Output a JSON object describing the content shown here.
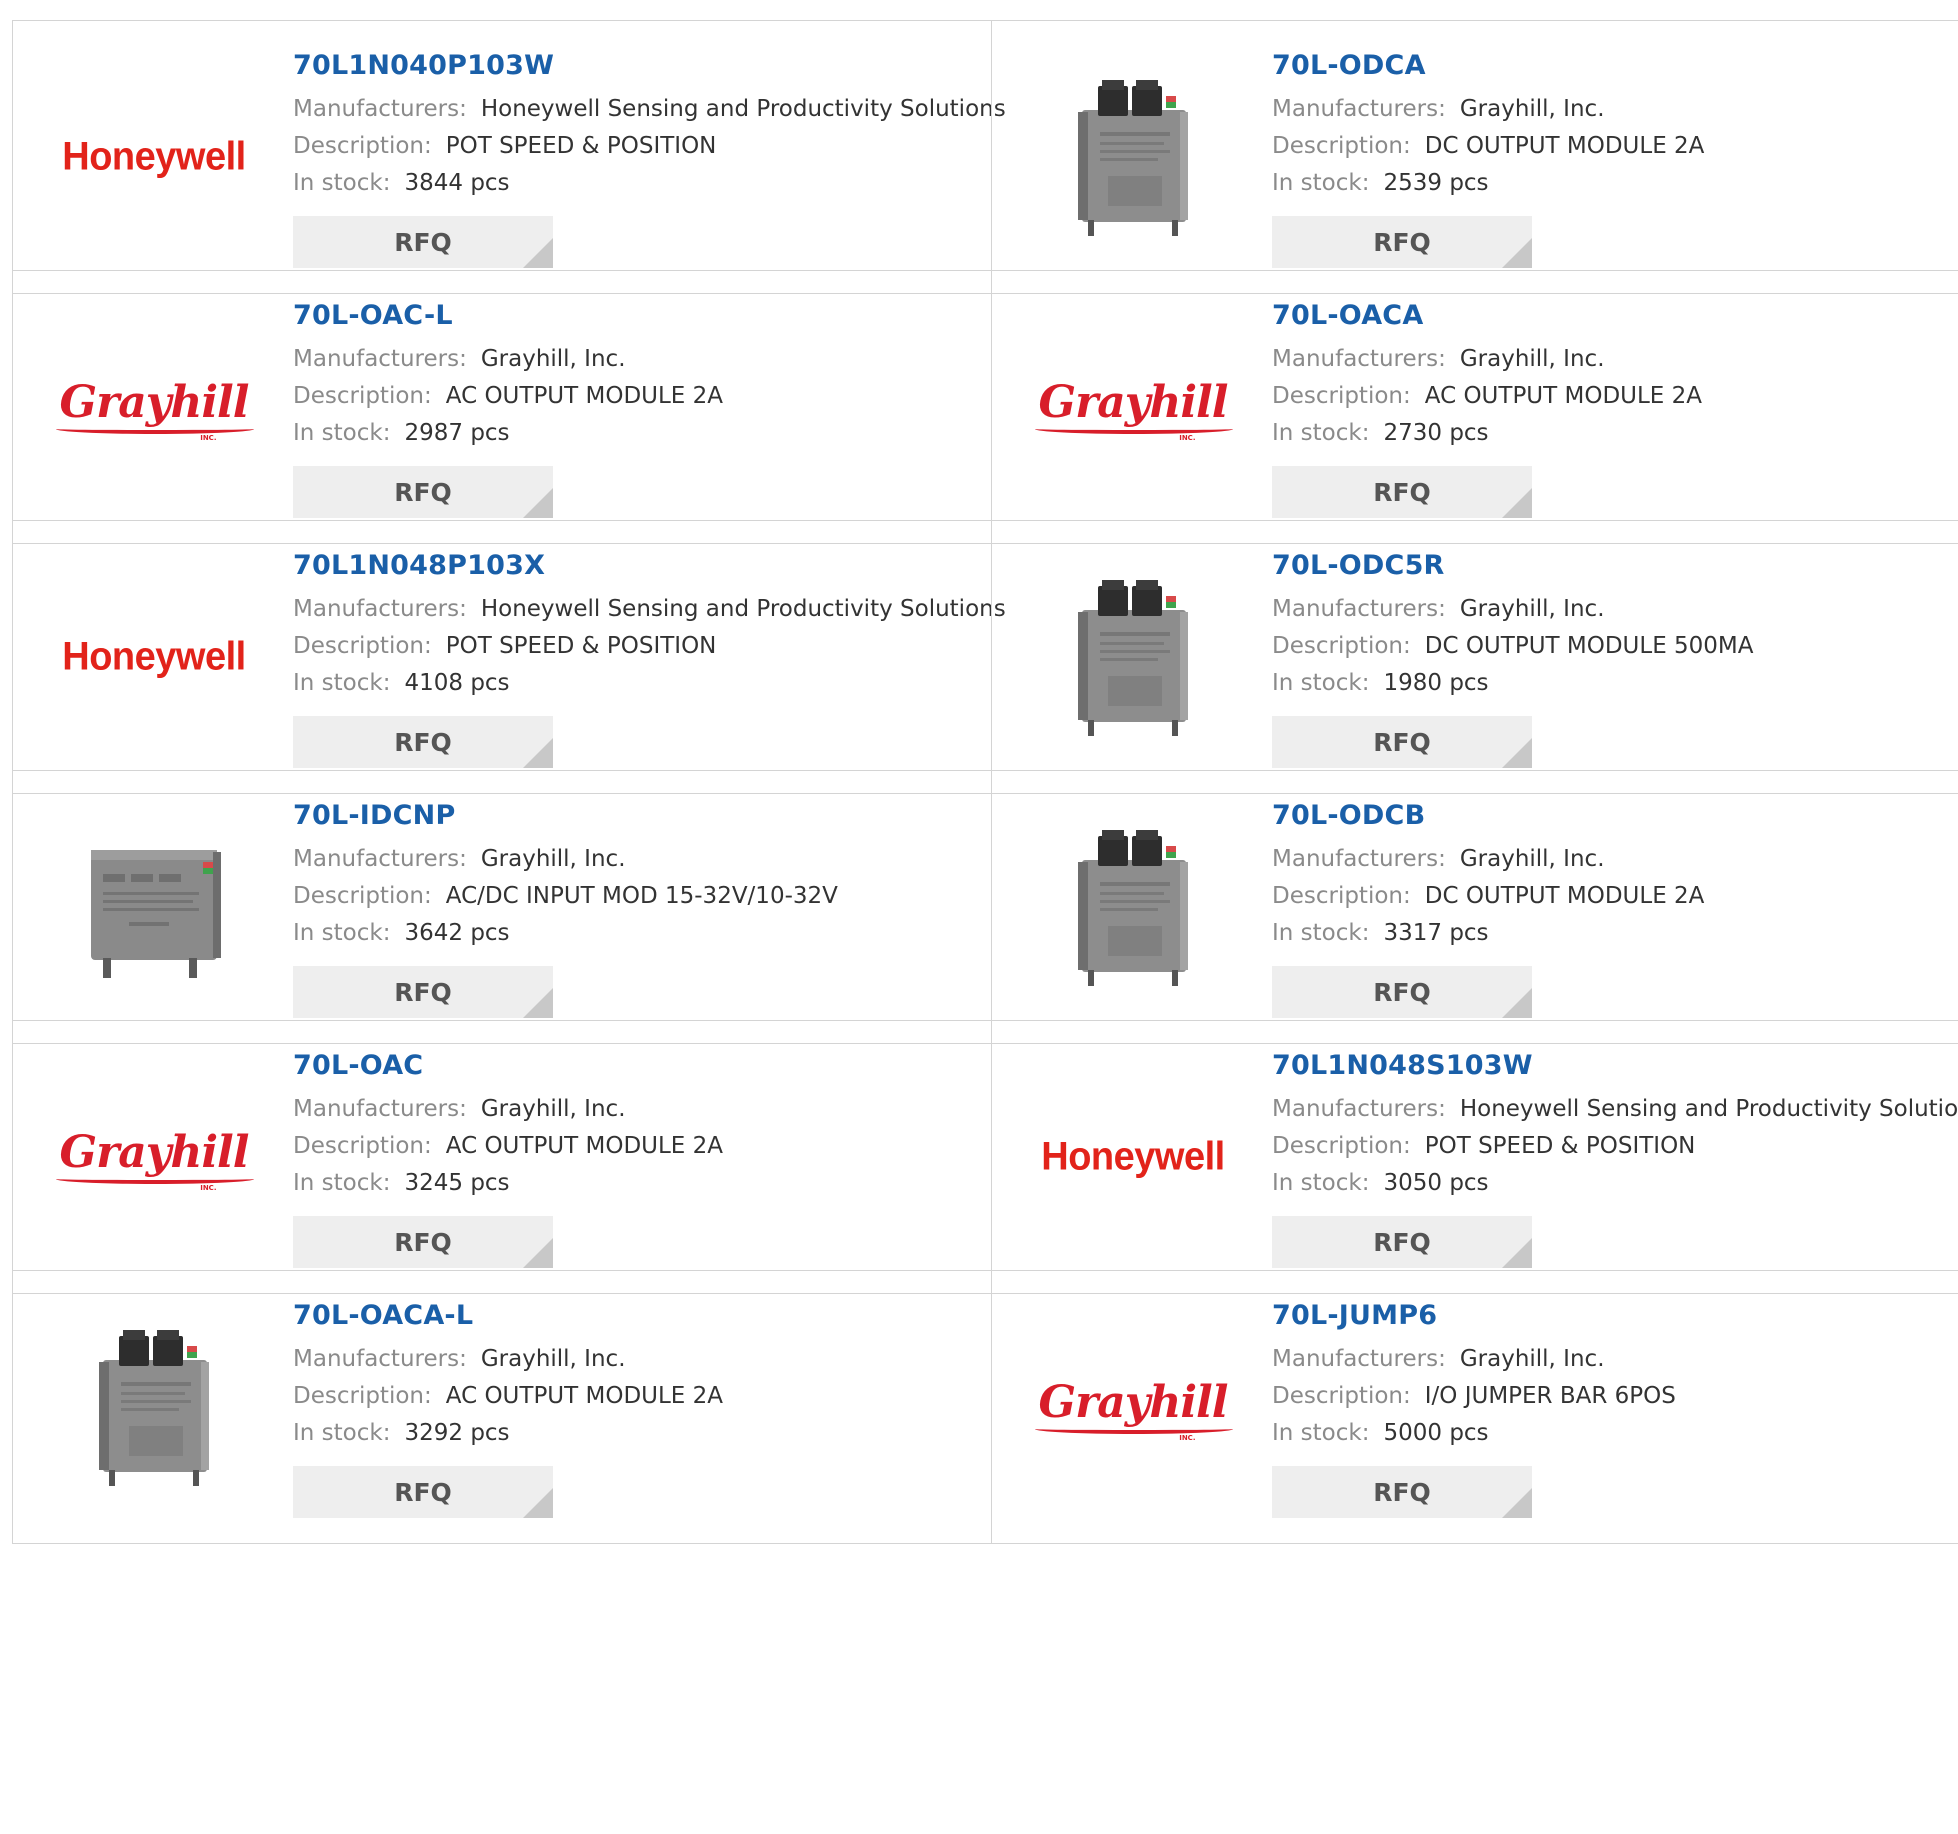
{
  "labels": {
    "manufacturers": "Manufacturers:",
    "description": "Description:",
    "in_stock": "In stock:",
    "rfq": "RFQ"
  },
  "products": [
    {
      "part": "70L1N040P103W",
      "manufacturer": "Honeywell Sensing and Productivity Solutions",
      "description": "POT SPEED & POSITION",
      "stock": "3844 pcs",
      "image": "honeywell-logo",
      "logo_text": "Honeywell"
    },
    {
      "part": "70L-ODCA",
      "manufacturer": "Grayhill, Inc.",
      "description": "DC OUTPUT MODULE 2A",
      "stock": "2539 pcs",
      "image": "io-module-photo"
    },
    {
      "part": "70L-OAC-L",
      "manufacturer": "Grayhill, Inc.",
      "description": "AC OUTPUT MODULE 2A",
      "stock": "2987 pcs",
      "image": "grayhill-logo",
      "logo_text": "Grayhill"
    },
    {
      "part": "70L-OACA",
      "manufacturer": "Grayhill, Inc.",
      "description": "AC OUTPUT MODULE 2A",
      "stock": "2730 pcs",
      "image": "grayhill-logo",
      "logo_text": "Grayhill"
    },
    {
      "part": "70L1N048P103X",
      "manufacturer": "Honeywell Sensing and Productivity Solutions",
      "description": "POT SPEED & POSITION",
      "stock": "4108 pcs",
      "image": "honeywell-logo",
      "logo_text": "Honeywell"
    },
    {
      "part": "70L-ODC5R",
      "manufacturer": "Grayhill, Inc.",
      "description": "DC OUTPUT MODULE 500MA",
      "stock": "1980 pcs",
      "image": "io-module-photo"
    },
    {
      "part": "70L-IDCNP",
      "manufacturer": "Grayhill, Inc.",
      "description": "AC/DC INPUT MOD 15-32V/10-32V",
      "stock": "3642 pcs",
      "image": "input-module-photo"
    },
    {
      "part": "70L-ODCB",
      "manufacturer": "Grayhill, Inc.",
      "description": "DC OUTPUT MODULE 2A",
      "stock": "3317 pcs",
      "image": "io-module-photo"
    },
    {
      "part": "70L-OAC",
      "manufacturer": "Grayhill, Inc.",
      "description": "AC OUTPUT MODULE 2A",
      "stock": "3245 pcs",
      "image": "grayhill-logo",
      "logo_text": "Grayhill"
    },
    {
      "part": "70L1N048S103W",
      "manufacturer": "Honeywell Sensing and Productivity Solutions",
      "description": "POT SPEED & POSITION",
      "stock": "3050 pcs",
      "image": "honeywell-logo",
      "logo_text": "Honeywell"
    },
    {
      "part": "70L-OACA-L",
      "manufacturer": "Grayhill, Inc.",
      "description": "AC OUTPUT MODULE 2A",
      "stock": "3292 pcs",
      "image": "io-module-photo"
    },
    {
      "part": "70L-JUMP6",
      "manufacturer": "Grayhill, Inc.",
      "description": "I/O JUMPER BAR 6POS",
      "stock": "5000 pcs",
      "image": "grayhill-logo",
      "logo_text": "Grayhill"
    }
  ],
  "colors": {
    "part_link": "#1a5fa8",
    "honeywell_red": "#e2231a",
    "grayhill_red": "#d81e2a",
    "border": "#d4d4d4",
    "button_bg": "#eeeeee"
  }
}
